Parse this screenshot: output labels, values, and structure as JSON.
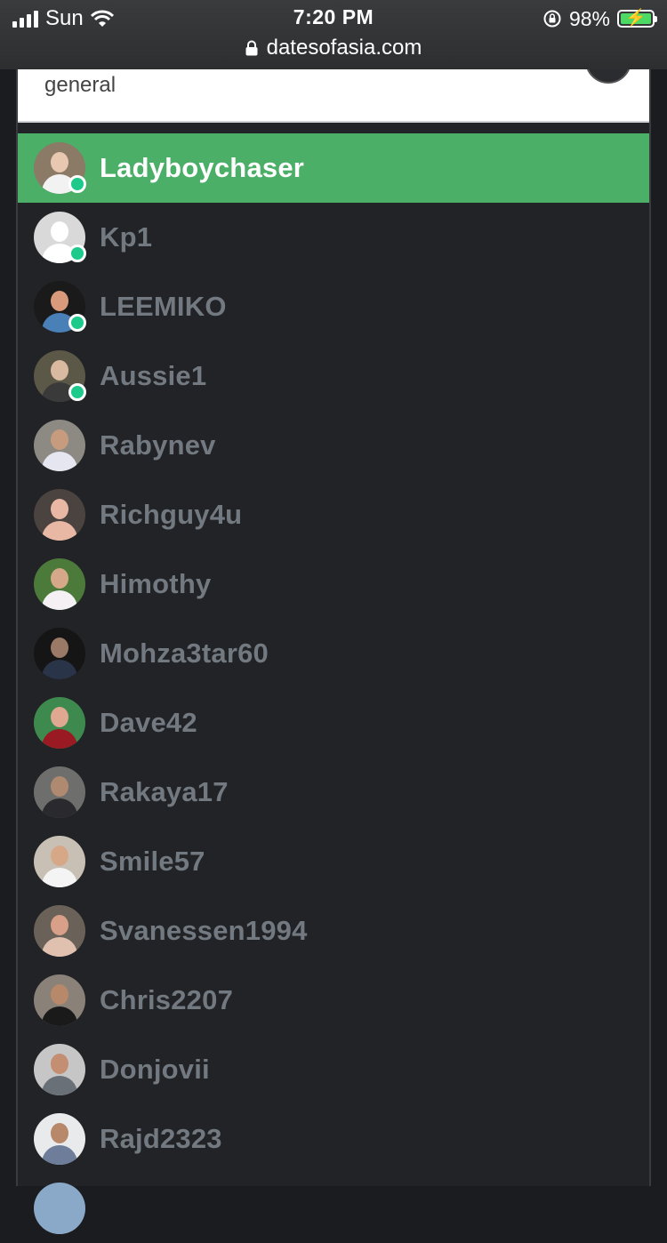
{
  "status_bar": {
    "carrier": "Sun",
    "time": "7:20 PM",
    "battery": "98%"
  },
  "browser": {
    "url": "datesofasia.com"
  },
  "room": {
    "name": "general"
  },
  "users": [
    {
      "name": "Ladyboychaser",
      "active": true,
      "online": true,
      "bg": "#8a7a66",
      "skin": "#e8c8b0",
      "shirt": "#f2f2f2"
    },
    {
      "name": "Kp1",
      "active": false,
      "online": true,
      "bg": "#d9d9d9",
      "skin": "#ffffff",
      "shirt": "#ffffff"
    },
    {
      "name": "LEEMIKO",
      "active": false,
      "online": true,
      "bg": "#1a1a1a",
      "skin": "#d89a7a",
      "shirt": "#4a80b8"
    },
    {
      "name": "Aussie1",
      "active": false,
      "online": true,
      "bg": "#5b5848",
      "skin": "#d9b9a0",
      "shirt": "#3a3a3a"
    },
    {
      "name": "Rabynev",
      "active": false,
      "online": false,
      "bg": "#8c8a82",
      "skin": "#c79c7e",
      "shirt": "#e6e6f0"
    },
    {
      "name": "Richguy4u",
      "active": false,
      "online": false,
      "bg": "#4a4340",
      "skin": "#e8b8a4",
      "shirt": "#e8b8a4"
    },
    {
      "name": "Himothy",
      "active": false,
      "online": false,
      "bg": "#4c7a3a",
      "skin": "#d6a88a",
      "shirt": "#f4f0f4"
    },
    {
      "name": "Mohza3tar60",
      "active": false,
      "online": false,
      "bg": "#151515",
      "skin": "#9a7a66",
      "shirt": "#2a3448"
    },
    {
      "name": "Dave42",
      "active": false,
      "online": false,
      "bg": "#3e8a4e",
      "skin": "#e0a890",
      "shirt": "#9a1a24"
    },
    {
      "name": "Rakaya17",
      "active": false,
      "online": false,
      "bg": "#6e6f6c",
      "skin": "#b08a70",
      "shirt": "#2a2a2e"
    },
    {
      "name": "Smile57",
      "active": false,
      "online": false,
      "bg": "#c8c0b4",
      "skin": "#d6a888",
      "shirt": "#f4f4f4"
    },
    {
      "name": "Svanessen1994",
      "active": false,
      "online": false,
      "bg": "#6a6258",
      "skin": "#d8a088",
      "shirt": "#e0c0ae"
    },
    {
      "name": "Chris2207",
      "active": false,
      "online": false,
      "bg": "#8a8278",
      "skin": "#b8886a",
      "shirt": "#1a1a1a"
    },
    {
      "name": "Donjovii",
      "active": false,
      "online": false,
      "bg": "#c6c6c6",
      "skin": "#c48e72",
      "shirt": "#6a7078"
    },
    {
      "name": "Rajd2323",
      "active": false,
      "online": false,
      "bg": "#e8eaec",
      "skin": "#b8886a",
      "shirt": "#6e7e9a"
    },
    {
      "name": "",
      "active": false,
      "online": false,
      "bg": "#8aa8c8",
      "skin": "#8aa8c8",
      "shirt": "#8aa8c8"
    }
  ]
}
